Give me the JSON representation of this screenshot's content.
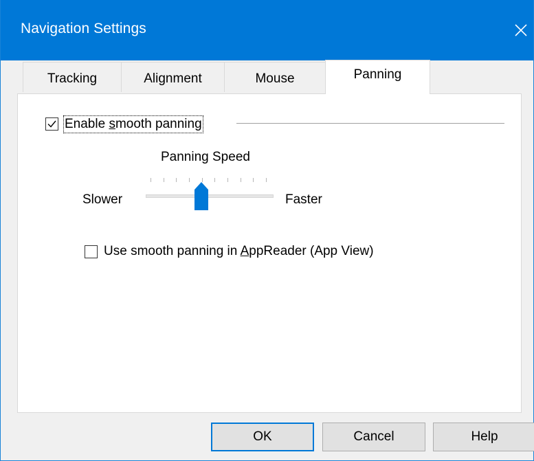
{
  "window": {
    "title": "Navigation Settings",
    "accent_color": "#0078d7",
    "close_icon": "close-icon"
  },
  "tabs": [
    {
      "label": "Tracking",
      "active": false
    },
    {
      "label": "Alignment",
      "active": false
    },
    {
      "label": "Mouse",
      "active": false
    },
    {
      "label": "Panning",
      "active": true
    }
  ],
  "panning": {
    "enable_smooth_panning": {
      "label_pre": "Enable ",
      "label_u": "s",
      "label_post": "mooth panning",
      "checked": true
    },
    "speed": {
      "label": "Panning Speed",
      "min_label": "Slower",
      "max_label": "Faster",
      "tick_count": 10,
      "value_fraction": 0.44
    },
    "appreader_option": {
      "label_pre": "Use smooth panning in ",
      "label_u": "A",
      "label_post": "ppReader (App View)",
      "checked": false
    }
  },
  "buttons": {
    "ok": "OK",
    "cancel": "Cancel",
    "help": "Help"
  }
}
